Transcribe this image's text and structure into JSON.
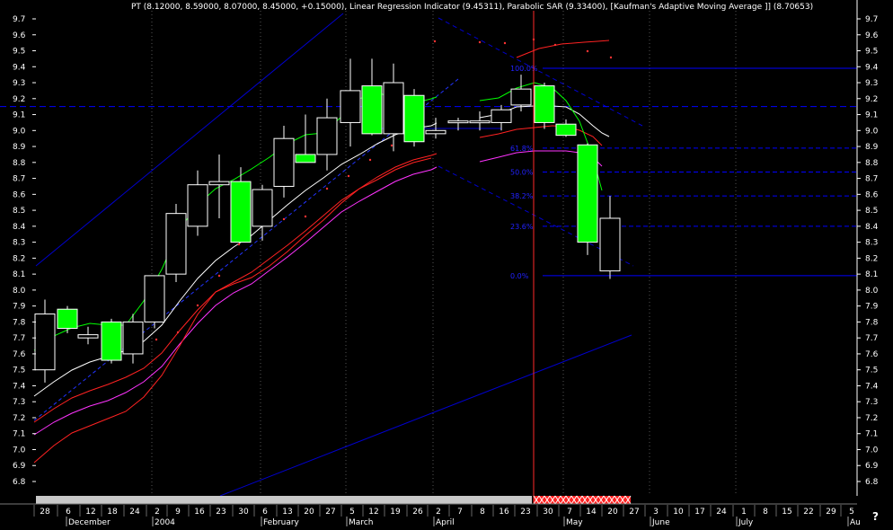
{
  "header": {
    "title": "PT (8.12000, 8.59000, 8.07000, 8.45000, +0.15000), Linear Regression Indicator (9.45311), Parabolic SAR (9.33400), [Kaufman's Adaptive Moving Average ]] (8.70653)"
  },
  "colors": {
    "background": "#000000",
    "up_candle": "#00ff00",
    "outline": "#ffffff",
    "regression": "#0000cc",
    "fib": "#0000ff",
    "vertical_marker": "#ff2a2a",
    "ma_white": "#ffffff",
    "ma_red": "#ff2222",
    "ma_magenta": "#ff33ff",
    "ma_green": "#00ff00",
    "sar_dots": "#ff3333"
  },
  "chart_data": {
    "type": "candlestick",
    "ylim": [
      6.75,
      9.8
    ],
    "y_ticks": [
      "6.8",
      "6.9",
      "7.0",
      "7.1",
      "7.2",
      "7.3",
      "7.4",
      "7.5",
      "7.6",
      "7.7",
      "7.8",
      "7.9",
      "8.0",
      "8.1",
      "8.2",
      "8.3",
      "8.4",
      "8.5",
      "8.6",
      "8.7",
      "8.8",
      "8.9",
      "9.0",
      "9.1",
      "9.2",
      "9.3",
      "9.4",
      "9.5",
      "9.6",
      "9.7"
    ],
    "x_day_labels": [
      "28",
      "6",
      "12",
      "18",
      "24",
      "2",
      "9",
      "16",
      "23",
      "30",
      "6",
      "13",
      "20",
      "27",
      "5",
      "12",
      "19",
      "26",
      "2",
      "7",
      "8",
      "16",
      "23",
      "30",
      "7",
      "14",
      "20",
      "27",
      "3",
      "10",
      "17",
      "24",
      "1",
      "8",
      "15",
      "22",
      "29",
      "5"
    ],
    "x_month_labels": [
      "December",
      "2004",
      "February",
      "March",
      "April",
      "May",
      "June",
      "July",
      "Au"
    ],
    "fib_levels": [
      {
        "label": "100.0%",
        "value": 9.39
      },
      {
        "label": "61.8%",
        "value": 8.89
      },
      {
        "label": "50.0%",
        "value": 8.74
      },
      {
        "label": "38.2%",
        "value": 8.59
      },
      {
        "label": "23.6%",
        "value": 8.4
      },
      {
        "label": "0.0%",
        "value": 8.09
      }
    ],
    "horizontal_dashed": 9.15,
    "candles": [
      {
        "o": 7.5,
        "h": 7.94,
        "l": 7.42,
        "c": 7.85,
        "dir": "up"
      },
      {
        "o": 7.88,
        "h": 7.9,
        "l": 7.73,
        "c": 7.76,
        "dir": "down"
      },
      {
        "o": 7.72,
        "h": 7.77,
        "l": 7.66,
        "c": 7.7,
        "dir": "flat"
      },
      {
        "o": 7.8,
        "h": 7.82,
        "l": 7.54,
        "c": 7.56,
        "dir": "down"
      },
      {
        "o": 7.6,
        "h": 7.85,
        "l": 7.54,
        "c": 7.8,
        "dir": "up"
      },
      {
        "o": 7.8,
        "h": 8.08,
        "l": 7.76,
        "c": 8.09,
        "dir": "up"
      },
      {
        "o": 8.1,
        "h": 8.54,
        "l": 8.05,
        "c": 8.48,
        "dir": "up"
      },
      {
        "o": 8.4,
        "h": 8.75,
        "l": 8.34,
        "c": 8.66,
        "dir": "up"
      },
      {
        "o": 8.66,
        "h": 8.85,
        "l": 8.45,
        "c": 8.68,
        "dir": "up"
      },
      {
        "o": 8.68,
        "h": 8.77,
        "l": 8.3,
        "c": 8.3,
        "dir": "down"
      },
      {
        "o": 8.4,
        "h": 8.66,
        "l": 8.31,
        "c": 8.63,
        "dir": "up"
      },
      {
        "o": 8.65,
        "h": 9.03,
        "l": 8.58,
        "c": 8.95,
        "dir": "up"
      },
      {
        "o": 8.85,
        "h": 9.1,
        "l": 8.8,
        "c": 8.8,
        "dir": "down"
      },
      {
        "o": 8.85,
        "h": 9.2,
        "l": 8.75,
        "c": 9.08,
        "dir": "up"
      },
      {
        "o": 9.05,
        "h": 9.45,
        "l": 8.9,
        "c": 9.25,
        "dir": "up"
      },
      {
        "o": 9.28,
        "h": 9.45,
        "l": 8.97,
        "c": 8.98,
        "dir": "down"
      },
      {
        "o": 8.98,
        "h": 9.42,
        "l": 8.87,
        "c": 9.3,
        "dir": "up"
      },
      {
        "o": 9.22,
        "h": 9.26,
        "l": 8.9,
        "c": 8.93,
        "dir": "down"
      },
      {
        "o": 8.98,
        "h": 9.08,
        "l": 8.95,
        "c": 9.0,
        "dir": "flat"
      },
      {
        "o": 9.05,
        "h": 9.08,
        "l": 9.0,
        "c": 9.06,
        "dir": "flat"
      },
      {
        "o": 9.05,
        "h": 9.12,
        "l": 9.0,
        "c": 9.06,
        "dir": "flat"
      },
      {
        "o": 9.05,
        "h": 9.16,
        "l": 9.0,
        "c": 9.13,
        "dir": "up"
      },
      {
        "o": 9.16,
        "h": 9.35,
        "l": 9.12,
        "c": 9.26,
        "dir": "up"
      },
      {
        "o": 9.28,
        "h": 9.3,
        "l": 9.01,
        "c": 9.05,
        "dir": "down"
      },
      {
        "o": 9.04,
        "h": 9.07,
        "l": 8.96,
        "c": 8.97,
        "dir": "down"
      },
      {
        "o": 8.91,
        "h": 8.92,
        "l": 8.22,
        "c": 8.3,
        "dir": "down"
      },
      {
        "o": 8.12,
        "h": 8.59,
        "l": 8.07,
        "c": 8.45,
        "dir": "up"
      }
    ]
  }
}
